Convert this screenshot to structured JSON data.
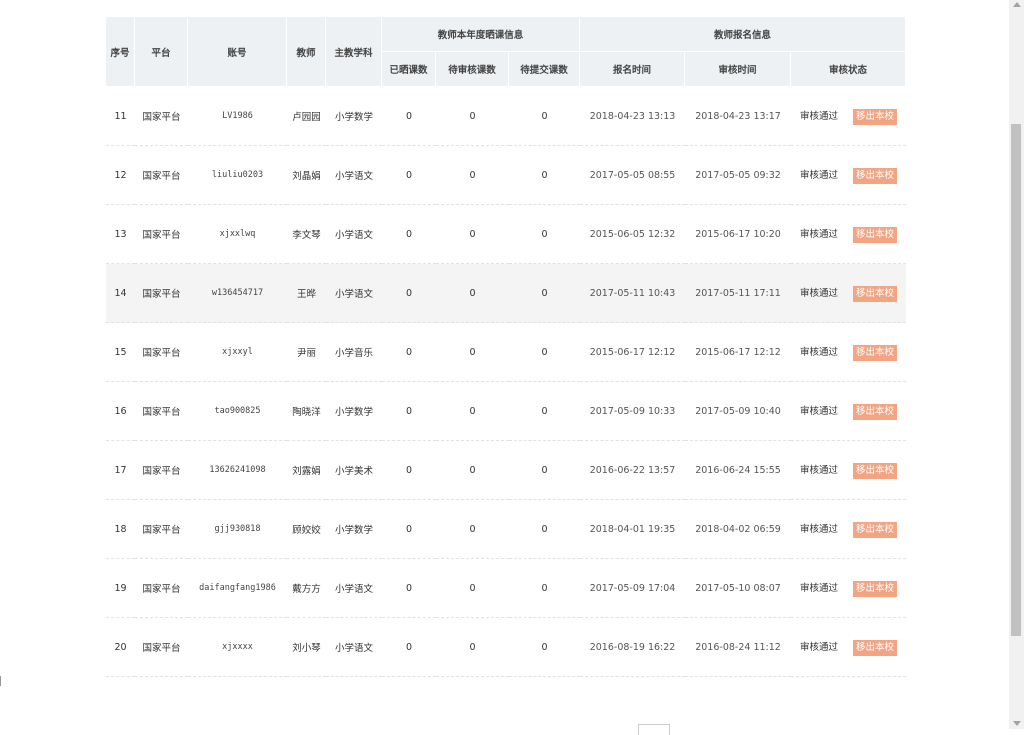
{
  "table": {
    "headers": {
      "index": "序号",
      "platform": "平台",
      "account": "账号",
      "teacher": "教师",
      "subject": "主教学科",
      "group_course_info": "教师本年度晒课信息",
      "group_signup_info": "教师报名信息",
      "uploaded": "已晒课数",
      "pending_review": "待审核课数",
      "pending_submit": "待提交课数",
      "signup_time": "报名时间",
      "review_time": "审核时间",
      "review_status": "审核状态"
    },
    "action_label": "移出本校",
    "rows": [
      {
        "index": "11",
        "platform": "国家平台",
        "account": "LV1986",
        "teacher": "卢园园",
        "subject": "小学数学",
        "uploaded": "0",
        "pending_review": "0",
        "pending_submit": "0",
        "signup_time": "2018-04-23 13:13",
        "review_time": "2018-04-23 13:17",
        "status": "审核通过"
      },
      {
        "index": "12",
        "platform": "国家平台",
        "account": "liuliu0203",
        "teacher": "刘晶娟",
        "subject": "小学语文",
        "uploaded": "0",
        "pending_review": "0",
        "pending_submit": "0",
        "signup_time": "2017-05-05 08:55",
        "review_time": "2017-05-05 09:32",
        "status": "审核通过"
      },
      {
        "index": "13",
        "platform": "国家平台",
        "account": "xjxxlwq",
        "teacher": "李文琴",
        "subject": "小学语文",
        "uploaded": "0",
        "pending_review": "0",
        "pending_submit": "0",
        "signup_time": "2015-06-05 12:32",
        "review_time": "2015-06-17 10:20",
        "status": "审核通过"
      },
      {
        "index": "14",
        "platform": "国家平台",
        "account": "w136454717",
        "teacher": "王晔",
        "subject": "小学语文",
        "uploaded": "0",
        "pending_review": "0",
        "pending_submit": "0",
        "signup_time": "2017-05-11 10:43",
        "review_time": "2017-05-11 17:11",
        "status": "审核通过"
      },
      {
        "index": "15",
        "platform": "国家平台",
        "account": "xjxxyl",
        "teacher": "尹丽",
        "subject": "小学音乐",
        "uploaded": "0",
        "pending_review": "0",
        "pending_submit": "0",
        "signup_time": "2015-06-17 12:12",
        "review_time": "2015-06-17 12:12",
        "status": "审核通过"
      },
      {
        "index": "16",
        "platform": "国家平台",
        "account": "tao900825",
        "teacher": "陶晓洋",
        "subject": "小学数学",
        "uploaded": "0",
        "pending_review": "0",
        "pending_submit": "0",
        "signup_time": "2017-05-09 10:33",
        "review_time": "2017-05-09 10:40",
        "status": "审核通过"
      },
      {
        "index": "17",
        "platform": "国家平台",
        "account": "13626241098",
        "teacher": "刘露娟",
        "subject": "小学美术",
        "uploaded": "0",
        "pending_review": "0",
        "pending_submit": "0",
        "signup_time": "2016-06-22 13:57",
        "review_time": "2016-06-24 15:55",
        "status": "审核通过"
      },
      {
        "index": "18",
        "platform": "国家平台",
        "account": "gjj930818",
        "teacher": "顾姣姣",
        "subject": "小学数学",
        "uploaded": "0",
        "pending_review": "0",
        "pending_submit": "0",
        "signup_time": "2018-04-01 19:35",
        "review_time": "2018-04-02 06:59",
        "status": "审核通过"
      },
      {
        "index": "19",
        "platform": "国家平台",
        "account": "daifangfang1986",
        "teacher": "戴方方",
        "subject": "小学语文",
        "uploaded": "0",
        "pending_review": "0",
        "pending_submit": "0",
        "signup_time": "2017-05-09 17:04",
        "review_time": "2017-05-10 08:07",
        "status": "审核通过"
      },
      {
        "index": "20",
        "platform": "国家平台",
        "account": "xjxxxx",
        "teacher": "刘小琴",
        "subject": "小学语文",
        "uploaded": "0",
        "pending_review": "0",
        "pending_submit": "0",
        "signup_time": "2016-08-19 16:22",
        "review_time": "2016-08-24 11:12",
        "status": "审核通过"
      }
    ]
  },
  "colors": {
    "header_bg": "#eef1f4",
    "action_bg": "#f2a483",
    "highlight_row_bg": "#f4f4f4"
  }
}
